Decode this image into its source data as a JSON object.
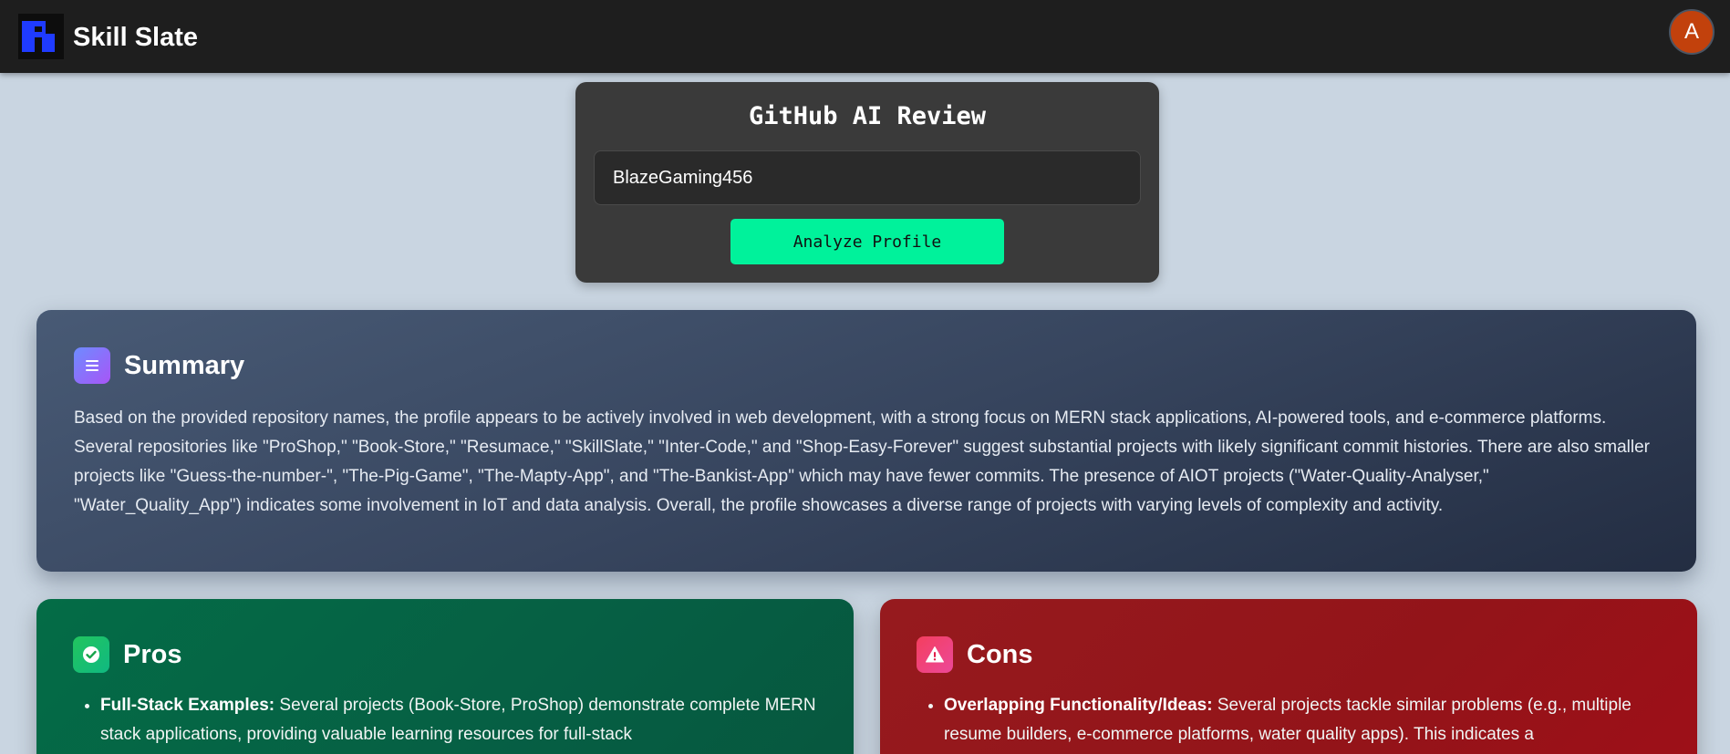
{
  "navbar": {
    "brand": "Skill Slate",
    "avatar_initial": "A"
  },
  "review": {
    "title": "GitHub AI Review",
    "username_value": "BlazeGaming456",
    "analyze_label": "Analyze Profile"
  },
  "summary": {
    "title": "Summary",
    "icon": "document-lines-icon",
    "text": "Based on the provided repository names, the profile appears to be actively involved in web development, with a strong focus on MERN stack applications, AI-powered tools, and e-commerce platforms. Several repositories like \"ProShop,\" \"Book-Store,\" \"Resumace,\" \"SkillSlate,\" \"Inter-Code,\" and \"Shop-Easy-Forever\" suggest substantial projects with likely significant commit histories. There are also smaller projects like \"Guess-the-number-\", \"The-Pig-Game\", \"The-Mapty-App\", and \"The-Bankist-App\" which may have fewer commits. The presence of AIOT projects (\"Water-Quality-Analyser,\" \"Water_Quality_App\") indicates some involvement in IoT and data analysis. Overall, the profile showcases a diverse range of projects with varying levels of complexity and activity."
  },
  "pros": {
    "title": "Pros",
    "icon": "check-circle-icon",
    "items": [
      {
        "title": "Full-Stack Examples:",
        "text": " Several projects (Book-Store, ProShop) demonstrate complete MERN stack applications, providing valuable learning resources for full-stack"
      }
    ]
  },
  "cons": {
    "title": "Cons",
    "icon": "warning-triangle-icon",
    "items": [
      {
        "title": "Overlapping Functionality/Ideas:",
        "text": " Several projects tackle similar problems (e.g., multiple resume builders, e-commerce platforms, water quality apps). This indicates a"
      }
    ]
  },
  "colors": {
    "navbar_bg": "#1e1e1e",
    "page_bg": "#c9d5e1",
    "logo_blue": "#1f3bff",
    "analyze_button": "#00f29b",
    "pros_bg": "#065f44",
    "cons_bg": "#961a1e"
  }
}
